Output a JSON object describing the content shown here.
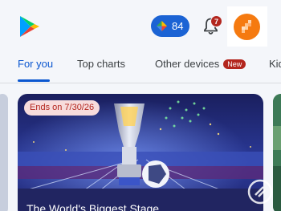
{
  "header": {
    "logo_icon": "google-play-logo",
    "points": {
      "icon": "play-points-diamond-icon",
      "value": "84"
    },
    "notifications": {
      "icon": "bell-icon",
      "count": "7"
    },
    "avatar_color": "#f57a10"
  },
  "tabs": [
    {
      "label": "For you",
      "active": true
    },
    {
      "label": "Top charts",
      "active": false
    },
    {
      "label": "Other devices",
      "badge": "New",
      "active": false
    },
    {
      "label": "Kids",
      "active": false
    }
  ],
  "featured_card": {
    "badge": "Ends on 7/30/26",
    "title": "The World's Biggest Stage"
  },
  "colors": {
    "accent": "#0b57d0",
    "points_chip": "#1b63d4",
    "badge_red": "#b3261e",
    "badge_pink": "#f7dcdc"
  }
}
